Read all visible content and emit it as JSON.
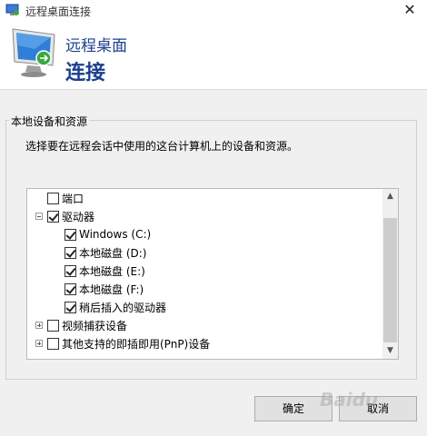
{
  "window": {
    "title": "远程桌面连接"
  },
  "banner": {
    "line1": "远程桌面",
    "line2": "连接"
  },
  "group": {
    "title": "本地设备和资源",
    "description": "选择要在远程会话中使用的这台计算机上的设备和资源。"
  },
  "tree": {
    "items": [
      {
        "label": "端口",
        "checked": false,
        "expander": "none"
      },
      {
        "label": "驱动器",
        "checked": true,
        "expander": "minus"
      },
      {
        "label": "Windows (C:)",
        "checked": true,
        "expander": "none"
      },
      {
        "label": "本地磁盘 (D:)",
        "checked": true,
        "expander": "none"
      },
      {
        "label": "本地磁盘 (E:)",
        "checked": true,
        "expander": "none"
      },
      {
        "label": "本地磁盘 (F:)",
        "checked": true,
        "expander": "none"
      },
      {
        "label": "稍后插入的驱动器",
        "checked": true,
        "expander": "none"
      },
      {
        "label": "视频捕获设备",
        "checked": false,
        "expander": "plus"
      },
      {
        "label": "其他支持的即插即用(PnP)设备",
        "checked": false,
        "expander": "plus"
      }
    ]
  },
  "buttons": {
    "ok": "确定",
    "cancel": "取消"
  },
  "watermark": "Baidu",
  "icons": {
    "close": "close-icon",
    "app": "remote-desktop-icon",
    "monitor": "monitor-icon"
  }
}
